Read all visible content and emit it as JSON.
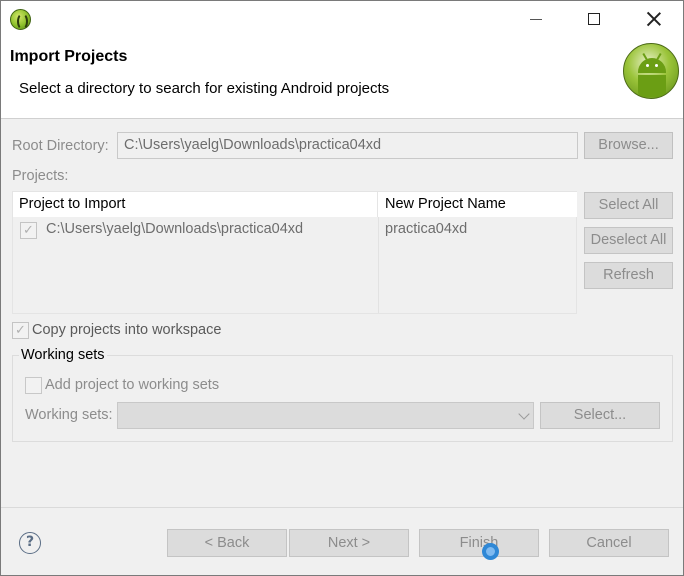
{
  "dialog": {
    "title": "Import Projects",
    "description": "Select a directory to search for existing Android projects"
  },
  "root_directory": {
    "label": "Root Directory:",
    "value": "C:\\Users\\yaelg\\Downloads\\practica04xd",
    "browse_label": "Browse..."
  },
  "projects": {
    "label": "Projects:",
    "columns": [
      "Project to Import",
      "New Project Name"
    ],
    "rows": [
      {
        "path": "C:\\Users\\yaelg\\Downloads\\practica04xd",
        "name": "practica04xd",
        "checked": true
      }
    ],
    "select_all_label": "Select All",
    "deselect_all_label": "Deselect All",
    "refresh_label": "Refresh"
  },
  "copy_into_workspace": {
    "label": "Copy projects into workspace",
    "checked": true
  },
  "working_sets": {
    "title": "Working sets",
    "add_label": "Add project to working sets",
    "add_checked": false,
    "sets_label": "Working sets:",
    "sets_value": "",
    "select_label": "Select..."
  },
  "footer": {
    "back_label": "< Back",
    "next_label": "Next >",
    "finish_label": "Finish",
    "cancel_label": "Cancel"
  },
  "colors": {
    "disabled_text": "#8c8c8c",
    "accent_android_green": "#9bc43a",
    "busy_cursor": "#2f88d6"
  },
  "icons": {
    "app": "eclipse-icon",
    "header": "android-logo-icon",
    "help": "help-icon"
  }
}
